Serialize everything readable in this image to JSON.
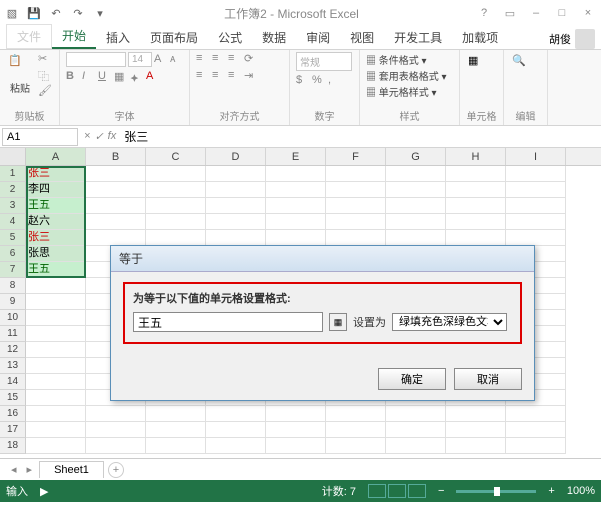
{
  "titlebar": {
    "doc_title": "工作簿2 - Microsoft Excel"
  },
  "ribbon": {
    "file": "文件",
    "tabs": [
      "开始",
      "插入",
      "页面布局",
      "公式",
      "数据",
      "审阅",
      "视图",
      "开发工具",
      "加载项"
    ],
    "active_tab": 0,
    "user_name": "胡俊",
    "font_name": "",
    "font_size": "14",
    "groups": {
      "clipboard": "剪贴板",
      "clipboard_paste": "粘贴",
      "font": "字体",
      "alignment": "对齐方式",
      "number": "数字",
      "styles": "样式",
      "cells": "单元格",
      "editing": "编辑",
      "general": "常规",
      "cond_fmt": "条件格式",
      "table_fmt": "套用表格格式",
      "cell_style": "单元格样式"
    }
  },
  "namebox": {
    "ref": "A1",
    "formula": "张三"
  },
  "columns": [
    "A",
    "B",
    "C",
    "D",
    "E",
    "F",
    "G",
    "H",
    "I"
  ],
  "cell_data": [
    {
      "text": "张三",
      "style": "red"
    },
    {
      "text": "李四",
      "style": ""
    },
    {
      "text": "王五",
      "style": "green"
    },
    {
      "text": "赵六",
      "style": ""
    },
    {
      "text": "张三",
      "style": "red"
    },
    {
      "text": "张思",
      "style": ""
    },
    {
      "text": "王五",
      "style": "green"
    }
  ],
  "visible_rows": 18,
  "dialog": {
    "title": "等于",
    "label": "为等于以下值的单元格设置格式:",
    "input_value": "王五",
    "set_as_label": "设置为",
    "format_option": "绿填充色深绿色文本",
    "ok": "确定",
    "cancel": "取消"
  },
  "sheets": {
    "active": "Sheet1"
  },
  "statusbar": {
    "mode": "输入",
    "count_label": "计数: 7",
    "zoom": "100%"
  }
}
